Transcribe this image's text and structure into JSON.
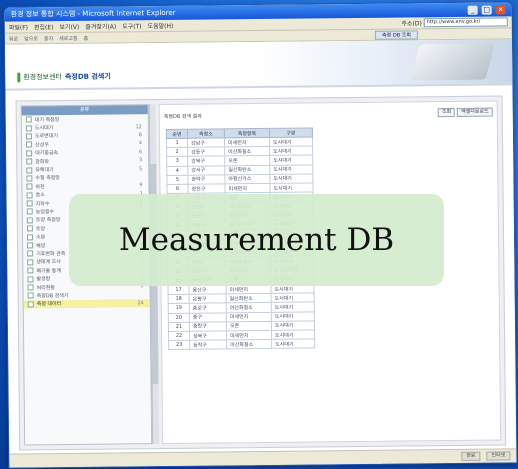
{
  "window": {
    "title": "환경 정보 통합 시스템 - Microsoft Internet Explorer",
    "min_label": "_",
    "max_label": "□",
    "close_label": "×"
  },
  "menubar": {
    "items": [
      "파일(F)",
      "편집(E)",
      "보기(V)",
      "즐겨찾기(A)",
      "도구(T)",
      "도움말(H)"
    ],
    "address_label": "주소(D)",
    "address_value": "http://www.env.go.kr/"
  },
  "toolbar": {
    "items": [
      "뒤로",
      "앞으로",
      "중지",
      "새로고침",
      "홈"
    ],
    "highlight": "측정 DB 조회"
  },
  "header": {
    "brand_left": "환경정보센터",
    "brand_right": "측정DB 검색기"
  },
  "sidebar": {
    "head": "분류",
    "items": [
      {
        "label": "대기 측정망",
        "count": ""
      },
      {
        "label": "도시대기",
        "count": "12"
      },
      {
        "label": "도로변대기",
        "count": "8"
      },
      {
        "label": "산성우",
        "count": "4"
      },
      {
        "label": "대기중금속",
        "count": "6"
      },
      {
        "label": "광화학",
        "count": "3"
      },
      {
        "label": "유해대기",
        "count": "5"
      },
      {
        "label": "수질 측정망",
        "count": ""
      },
      {
        "label": "하천",
        "count": "9"
      },
      {
        "label": "호소",
        "count": "7"
      },
      {
        "label": "지하수",
        "count": "4"
      },
      {
        "label": "농업용수",
        "count": "3"
      },
      {
        "label": "토양 측정망",
        "count": ""
      },
      {
        "label": "토양",
        "count": "11"
      },
      {
        "label": "소음",
        "count": "6"
      },
      {
        "label": "해양",
        "count": "5"
      },
      {
        "label": "기후변화 관측",
        "count": "2"
      },
      {
        "label": "생태계 조사",
        "count": "3"
      },
      {
        "label": "폐기물 통계",
        "count": ""
      },
      {
        "label": "발생량",
        "count": "4"
      },
      {
        "label": "처리현황",
        "count": "3"
      },
      {
        "label": "측정DB 검색기",
        "count": ""
      },
      {
        "label": "측정 데이터",
        "count": "24"
      }
    ]
  },
  "panel": {
    "title": "측정DB 검색 결과",
    "buttons": [
      "조회",
      "엑셀다운로드"
    ],
    "columns": [
      "순번",
      "측정소",
      "측정항목",
      "구분"
    ],
    "rows": [
      [
        "1",
        "강남구",
        "미세먼지",
        "도시대기"
      ],
      [
        "2",
        "강동구",
        "이산화질소",
        "도시대기"
      ],
      [
        "3",
        "강북구",
        "오존",
        "도시대기"
      ],
      [
        "4",
        "강서구",
        "일산화탄소",
        "도시대기"
      ],
      [
        "5",
        "관악구",
        "아황산가스",
        "도시대기"
      ],
      [
        "6",
        "광진구",
        "미세먼지",
        "도시대기"
      ],
      [
        "7",
        "구로구",
        "오존",
        "도시대기"
      ],
      [
        "8",
        "금천구",
        "이산화질소",
        "도시대기"
      ],
      [
        "9",
        "노원구",
        "미세먼지",
        "도시대기"
      ],
      [
        "10",
        "도봉구",
        "일산화탄소",
        "도시대기"
      ],
      [
        "11",
        "마포구",
        "오존",
        "도시대기"
      ],
      [
        "12",
        "서초구",
        "미세먼지",
        "도시대기"
      ],
      [
        "13",
        "성동구",
        "아황산가스",
        "도시대기"
      ],
      [
        "14",
        "송파구",
        "이산화질소",
        "도시대기"
      ],
      [
        "15",
        "양천구",
        "미세먼지",
        "도로변대기"
      ],
      [
        "16",
        "영등포구",
        "오존",
        "도시대기"
      ],
      [
        "17",
        "용산구",
        "미세먼지",
        "도시대기"
      ],
      [
        "18",
        "은평구",
        "일산화탄소",
        "도시대기"
      ],
      [
        "19",
        "종로구",
        "이산화질소",
        "도시대기"
      ],
      [
        "20",
        "중구",
        "미세먼지",
        "도시대기"
      ],
      [
        "21",
        "중랑구",
        "오존",
        "도시대기"
      ],
      [
        "22",
        "성북구",
        "미세먼지",
        "도시대기"
      ],
      [
        "23",
        "동작구",
        "이산화질소",
        "도시대기"
      ]
    ]
  },
  "statusbar": {
    "left": "완료",
    "zone": "인터넷"
  },
  "overlay": {
    "label": "Measurement DB"
  }
}
